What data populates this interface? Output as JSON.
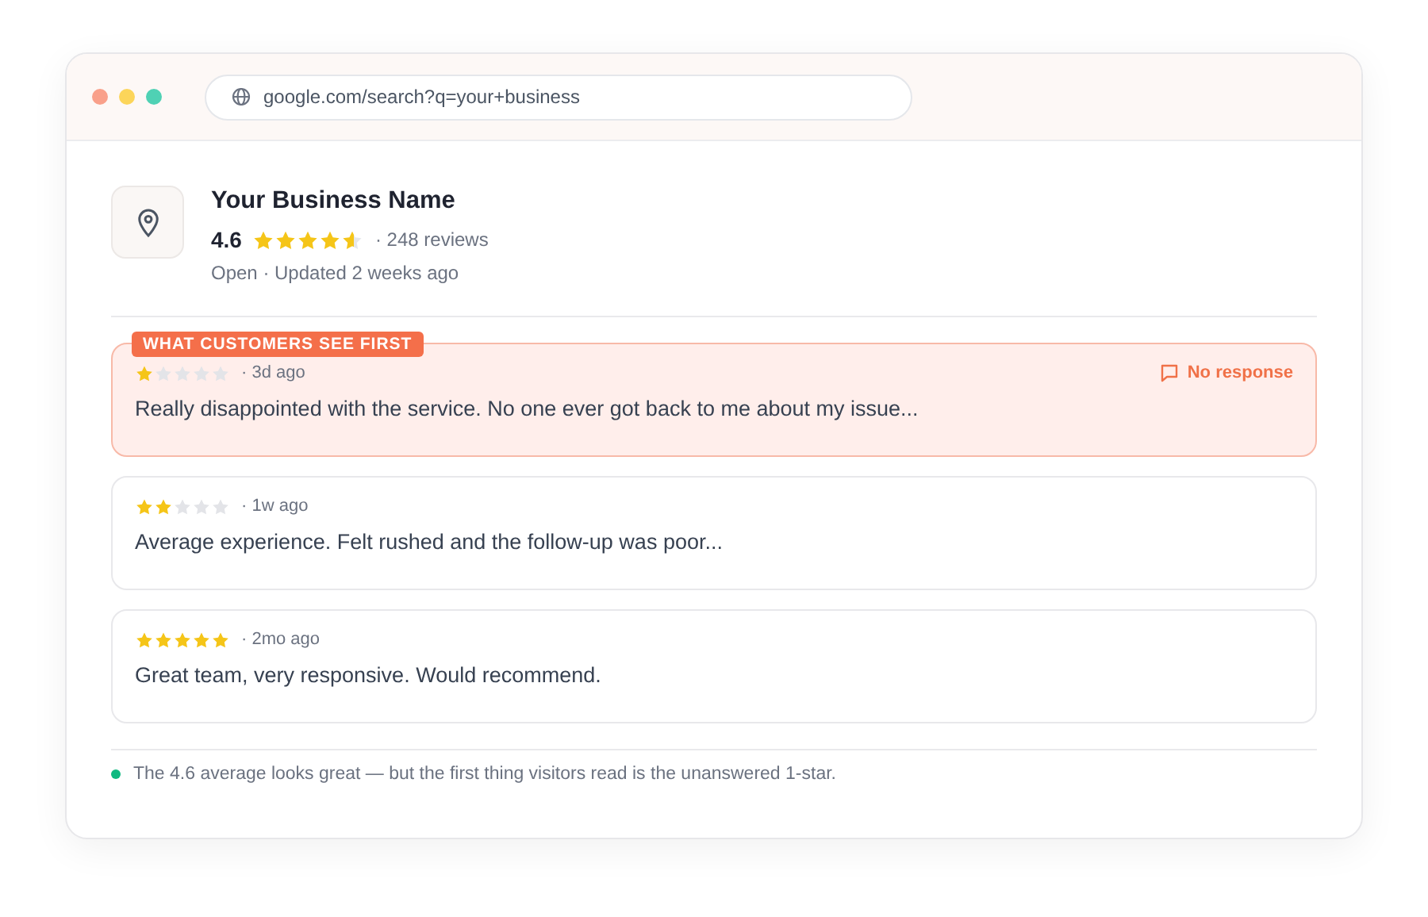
{
  "browser": {
    "url": "google.com/search?q=your+business"
  },
  "business": {
    "name": "Your Business Name",
    "rating": "4.6",
    "stars": 4.6,
    "reviews": "· 248 reviews",
    "status": "Open · Updated 2 weeks ago"
  },
  "reviews": [
    {
      "stars": 1,
      "age": "· 3d ago",
      "text": "Really disappointed with the service. No one ever got back to me about my issue...",
      "highlighted": true,
      "badge": "WHAT CUSTOMERS SEE FIRST",
      "response": "No response"
    },
    {
      "stars": 2,
      "age": "· 1w ago",
      "text": "Average experience. Felt rushed and the follow-up was poor...",
      "highlighted": false
    },
    {
      "stars": 5,
      "age": "· 2mo ago",
      "text": "Great team, very responsive. Would recommend.",
      "highlighted": false
    }
  ],
  "footnote": {
    "text": "The 4.6 average looks great — but the first thing visitors read is the unanswered 1-star.",
    "color": "#10b981"
  }
}
